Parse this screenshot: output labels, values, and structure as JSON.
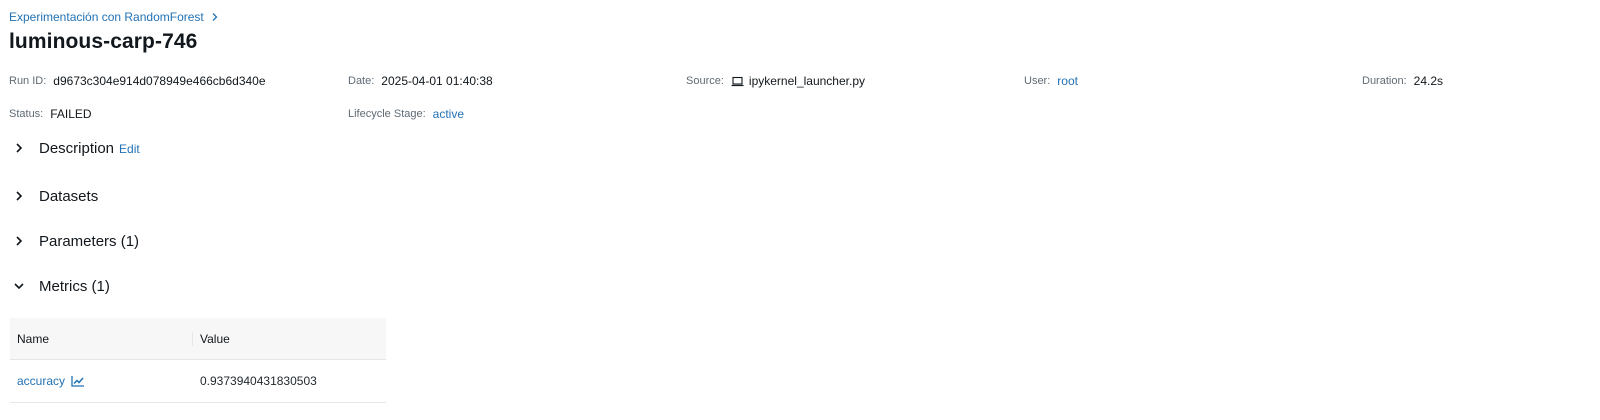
{
  "breadcrumb": {
    "experiment": "Experimentación con RandomForest"
  },
  "run": {
    "name": "luminous-carp-746"
  },
  "meta": {
    "run_id": {
      "label": "Run ID:",
      "value": "d9673c304e914d078949e466cb6d340e"
    },
    "date": {
      "label": "Date:",
      "value": "2025-04-01 01:40:38"
    },
    "source": {
      "label": "Source:",
      "value": "ipykernel_launcher.py",
      "icon": "laptop-icon"
    },
    "user": {
      "label": "User:",
      "value": "root"
    },
    "duration": {
      "label": "Duration:",
      "value": "24.2s"
    },
    "status": {
      "label": "Status:",
      "value": "FAILED"
    },
    "lifecycle": {
      "label": "Lifecycle Stage:",
      "value": "active"
    }
  },
  "sections": {
    "description": {
      "label": "Description",
      "edit": "Edit",
      "expanded": false
    },
    "datasets": {
      "label": "Datasets",
      "expanded": false
    },
    "parameters": {
      "label": "Parameters (1)",
      "expanded": false
    },
    "metrics": {
      "label": "Metrics (1)",
      "expanded": true
    }
  },
  "metrics_table": {
    "columns": [
      "Name",
      "Value"
    ],
    "rows": [
      {
        "name": "accuracy",
        "value": "0.9373940431830503",
        "icon": "line-chart-icon"
      }
    ]
  },
  "colors": {
    "link": "#2272b4",
    "text": "#11171c",
    "muted": "#5f6b75",
    "header_bg": "#f7f7f7",
    "border": "#e4e7ea"
  }
}
